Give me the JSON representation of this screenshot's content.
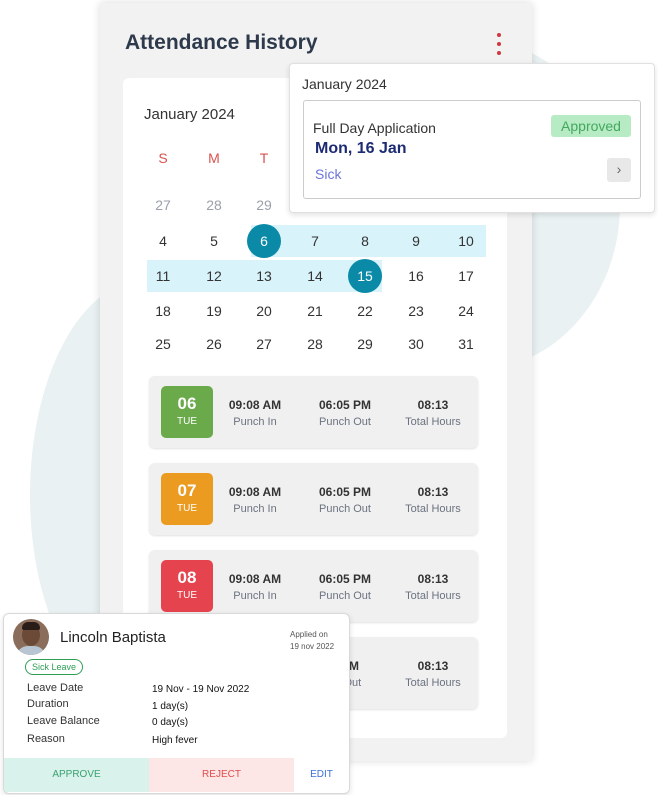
{
  "app": {
    "title": "Attendance History"
  },
  "calendar": {
    "month": "January 2024",
    "weekdays": [
      "S",
      "M",
      "T"
    ],
    "rows": [
      [
        "27",
        "28",
        "29"
      ],
      [
        "4",
        "5",
        "6",
        "7",
        "8",
        "9",
        "10"
      ],
      [
        "11",
        "12",
        "13",
        "14",
        "15",
        "16",
        "17"
      ],
      [
        "18",
        "19",
        "20",
        "21",
        "22",
        "23",
        "24"
      ],
      [
        "25",
        "26",
        "27",
        "28",
        "29",
        "30",
        "31"
      ]
    ],
    "selected_days": [
      "6",
      "15"
    ],
    "highlight_color": "#d9f3fa",
    "selected_color": "#0a8aa7"
  },
  "records": [
    {
      "day": "06",
      "weekday": "TUE",
      "color": "#6aaa4a",
      "punch_in": "09:08 AM",
      "punch_in_label": "Punch In",
      "punch_out": "06:05 PM",
      "punch_out_label": "Punch Out",
      "total": "08:13",
      "total_label": "Total Hours"
    },
    {
      "day": "07",
      "weekday": "TUE",
      "color": "#ea9b20",
      "punch_in": "09:08 AM",
      "punch_in_label": "Punch In",
      "punch_out": "06:05 PM",
      "punch_out_label": "Punch Out",
      "total": "08:13",
      "total_label": "Total Hours"
    },
    {
      "day": "08",
      "weekday": "TUE",
      "color": "#e5444f",
      "punch_in": "09:08 AM",
      "punch_in_label": "Punch In",
      "punch_out": "06:05 PM",
      "punch_out_label": "Punch Out",
      "total": "08:13",
      "total_label": "Total Hours"
    },
    {
      "punch_out": "5 PM",
      "punch_out_label": "ch Out",
      "total": "08:13",
      "total_label": "Total Hours"
    }
  ],
  "popup": {
    "month": "January 2024",
    "application_type": "Full Day Application",
    "status": "Approved",
    "date": "Mon, 16 Jan",
    "reason": "Sick",
    "arrow": "›"
  },
  "leave_card": {
    "name": "Lincoln Baptista",
    "applied_label": "Applied on",
    "applied_date": "19 nov 2022",
    "tag": "Sick Leave",
    "fields": [
      {
        "label": "Leave Date",
        "value": "19 Nov - 19 Nov 2022"
      },
      {
        "label": "Duration",
        "value": "1 day(s)"
      },
      {
        "label": "Leave Balance",
        "value": "0 day(s)"
      },
      {
        "label": "Reason",
        "value": "High fever"
      }
    ],
    "actions": {
      "approve": "APPROVE",
      "reject": "REJECT",
      "edit": "EDIT"
    }
  }
}
